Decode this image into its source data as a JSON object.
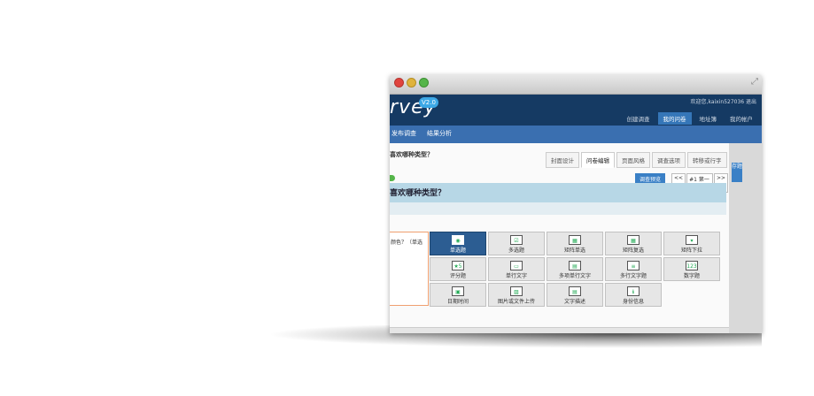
{
  "header": {
    "logo_text": "rvey",
    "version": "V2.0",
    "user_info": "欢迎您,kaixin527036  退出",
    "nav": [
      "创建调查",
      "我的问卷",
      "地址簿",
      "我的帐户"
    ]
  },
  "subnav": {
    "items": [
      "发布调查",
      "结果分析"
    ]
  },
  "main": {
    "question_title": "喜欢哪种类型？",
    "tabs": [
      "封面设计",
      "问卷编辑",
      "页面风格",
      "调查选项",
      "转移或行字"
    ],
    "preview_label": "调查预览",
    "pager": {
      "prev": "<<",
      "current": "#1 第一页 ▾",
      "next": ">>"
    },
    "banner_title": "喜欢哪种类型？",
    "left_question": "颜色？（单选"
  },
  "question_types": [
    {
      "label": "单选题",
      "icon": "◉"
    },
    {
      "label": "多选题",
      "icon": "☑"
    },
    {
      "label": "矩阵单选",
      "icon": "▦"
    },
    {
      "label": "矩阵复选",
      "icon": "▦"
    },
    {
      "label": "矩阵下拉",
      "icon": "▾"
    },
    {
      "label": "评分题",
      "icon": "★5"
    },
    {
      "label": "单行文字",
      "icon": "▭"
    },
    {
      "label": "多项单行文字",
      "icon": "▤"
    },
    {
      "label": "多行文字题",
      "icon": "≡"
    },
    {
      "label": "数字题",
      "icon": "123"
    },
    {
      "label": "日期时间",
      "icon": "▣"
    },
    {
      "label": "图片或文件上传",
      "icon": "▨"
    },
    {
      "label": "文字描述",
      "icon": "▤"
    },
    {
      "label": "身份信息",
      "icon": "ℹ"
    }
  ],
  "side": {
    "button": "存题"
  },
  "colors": {
    "header": "#153a63",
    "subnav": "#3a6fb0",
    "accent": "#3a80c6",
    "selected_cell": "#2c5d92",
    "banner": "#b7d7e6"
  }
}
